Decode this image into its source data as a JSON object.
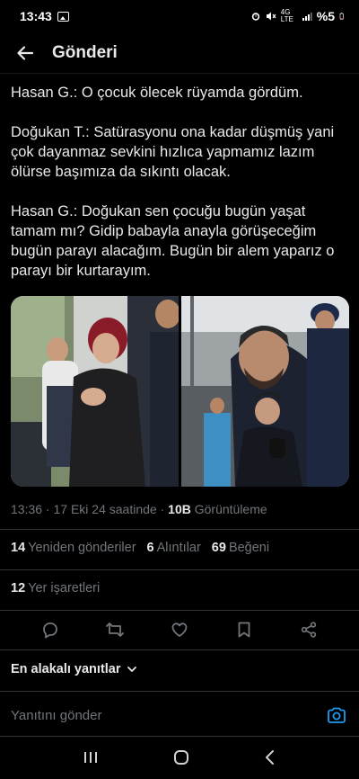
{
  "status_bar": {
    "time": "13:43",
    "network": "4G LTE",
    "battery": "%5"
  },
  "header": {
    "title": "Gönderi"
  },
  "post": {
    "paragraphs": [
      "Hasan G.: O çocuk ölecek rüyamda gördüm.",
      "Doğukan T.: Satürasyonu ona kadar düşmüş yani çok dayanmaz sevkini hızlıca yapmamız lazım ölürse başımıza da sıkıntı olacak.",
      "Hasan G.: Doğukan sen çocuğu bugün yaşat tamam mı? Gidip babayla anayla görüşeceğim bugün parayı alacağım. Bugün bir alem yaparız o parayı bir kurtarayım."
    ],
    "time": "13:36",
    "date": "17 Eki 24 saatinde",
    "views": "10B",
    "views_label": "Görüntüleme"
  },
  "stats": {
    "reposts_count": "14",
    "reposts_label": "Yeniden gönderiler",
    "quotes_count": "6",
    "quotes_label": "Alıntılar",
    "likes_count": "69",
    "likes_label": "Beğeni",
    "bookmarks_count": "12",
    "bookmarks_label": "Yer işaretleri"
  },
  "replies": {
    "sort_label": "En alakalı yanıtlar",
    "input_placeholder": "Yanıtını gönder"
  },
  "colors": {
    "background": "#000000",
    "text": "#e7e9ea",
    "muted": "#71767b",
    "accent": "#1d9bf0",
    "divider": "#2f3336"
  },
  "icons": [
    "back-arrow-icon",
    "reply-icon",
    "repost-icon",
    "like-icon",
    "bookmark-icon",
    "share-icon",
    "chevron-down-icon",
    "camera-icon",
    "recent-apps-icon",
    "home-icon",
    "back-nav-icon"
  ]
}
